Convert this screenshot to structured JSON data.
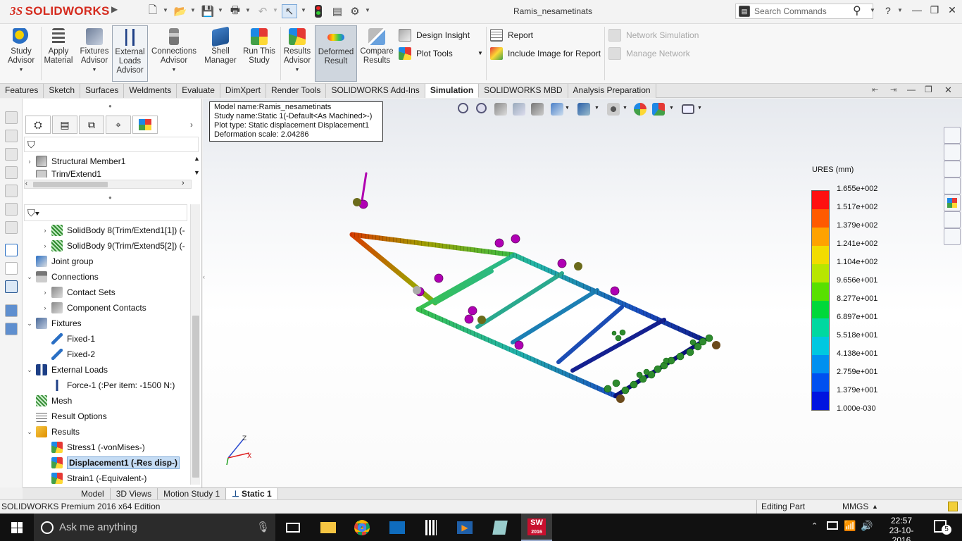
{
  "app": {
    "logo_text": "SOLIDWORKS",
    "logo_mark": "3S",
    "doc_title": "Ramis_nesametinats"
  },
  "search": {
    "placeholder": "Search Commands",
    "help": "?"
  },
  "window": {
    "minimize": "—",
    "restore": "❐",
    "close": "✕",
    "min2": "—",
    "restore2": "❐"
  },
  "ribbon": {
    "buttons": [
      {
        "label": "Study Advisor"
      },
      {
        "label": "Apply Material"
      },
      {
        "label": "Fixtures Advisor"
      },
      {
        "label": "External Loads Advisor"
      },
      {
        "label": "Connections Advisor"
      },
      {
        "label": "Shell Manager"
      },
      {
        "label": "Run This Study"
      },
      {
        "label": "Results Advisor"
      },
      {
        "label": "Deformed Result"
      },
      {
        "label": "Compare Results"
      }
    ],
    "design_insight": "Design Insight",
    "plot_tools": "Plot Tools",
    "report": "Report",
    "include_image": "Include Image for Report",
    "network_simulation": "Network Simulation",
    "manage_network": "Manage Network"
  },
  "tabs": [
    "Features",
    "Sketch",
    "Surfaces",
    "Weldments",
    "Evaluate",
    "DimXpert",
    "Render Tools",
    "SOLIDWORKS Add-Ins",
    "Simulation",
    "SOLIDWORKS MBD",
    "Analysis Preparation"
  ],
  "selected_tab": "Simulation",
  "tree_top": [
    "Structural Member1",
    "Trim/Extend1"
  ],
  "tree": [
    {
      "label": "SolidBody 8(Trim/Extend1[1]) (-",
      "indent": 1,
      "exp": "›"
    },
    {
      "label": "SolidBody 9(Trim/Extend5[2]) (-",
      "indent": 1,
      "exp": "›"
    },
    {
      "label": "Joint group",
      "indent": 0,
      "exp": ""
    },
    {
      "label": "Connections",
      "indent": 0,
      "exp": "⌄"
    },
    {
      "label": "Contact Sets",
      "indent": 1,
      "exp": "›"
    },
    {
      "label": "Component Contacts",
      "indent": 1,
      "exp": "›"
    },
    {
      "label": "Fixtures",
      "indent": 0,
      "exp": "⌄"
    },
    {
      "label": "Fixed-1",
      "indent": 1,
      "exp": ""
    },
    {
      "label": "Fixed-2",
      "indent": 1,
      "exp": ""
    },
    {
      "label": "External Loads",
      "indent": 0,
      "exp": "⌄"
    },
    {
      "label": "Force-1 (:Per item: -1500 N:)",
      "indent": 1,
      "exp": ""
    },
    {
      "label": "Mesh",
      "indent": 0,
      "exp": ""
    },
    {
      "label": "Result Options",
      "indent": 0,
      "exp": ""
    },
    {
      "label": "Results",
      "indent": 0,
      "exp": "⌄"
    },
    {
      "label": "Stress1 (-vonMises-)",
      "indent": 1,
      "exp": ""
    },
    {
      "label": "Displacement1 (-Res disp-)",
      "indent": 1,
      "exp": "",
      "selected": true
    },
    {
      "label": "Strain1 (-Equivalent-)",
      "indent": 1,
      "exp": ""
    }
  ],
  "info": {
    "model": "Model name:Ramis_nesametinats",
    "study": "Study name:Static 1(-Default<As Machined>-)",
    "plot": "Plot type: Static displacement Displacement1",
    "scale": "Deformation scale: 2.04286"
  },
  "legend": {
    "title": "URES (mm)",
    "labels": [
      "1.655e+002",
      "1.517e+002",
      "1.379e+002",
      "1.241e+002",
      "1.104e+002",
      "9.656e+001",
      "8.277e+001",
      "6.897e+001",
      "5.518e+001",
      "4.138e+001",
      "2.759e+001",
      "1.379e+001",
      "1.000e-030"
    ],
    "colors": [
      "#ff0000",
      "#ff6a00",
      "#ffb400",
      "#d8e000",
      "#8ce000",
      "#00d400",
      "#00d48c",
      "#00d4d4",
      "#00a0e6",
      "#0064f0",
      "#0028e6",
      "#0000d8"
    ]
  },
  "bottom_tabs": [
    "Model",
    "3D Views",
    "Motion Study 1",
    "Static 1"
  ],
  "status": {
    "edition": "SOLIDWORKS Premium 2016 x64 Edition",
    "mode": "Editing Part",
    "units": "MMGS"
  },
  "taskbar": {
    "search": "Ask me anything",
    "time": "22:57",
    "date": "23-10-2016",
    "notif": "5",
    "sw_label": "SW",
    "sw_year": "2016"
  }
}
